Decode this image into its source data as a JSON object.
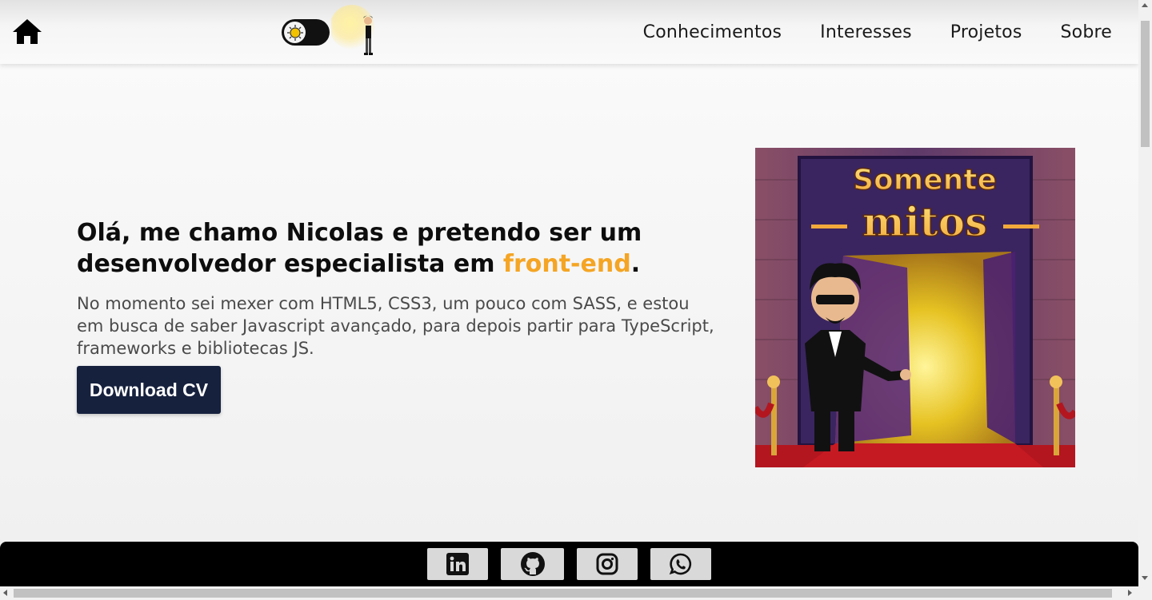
{
  "header": {
    "nav": [
      {
        "label": "Conhecimentos"
      },
      {
        "label": "Interesses"
      },
      {
        "label": "Projetos"
      },
      {
        "label": "Sobre"
      }
    ],
    "icons": {
      "home": "home-icon",
      "theme": "sun-icon"
    }
  },
  "hero": {
    "title_part1": "Olá, me chamo Nicolas e pretendo ser um desenvolvedor especialista em ",
    "title_accent": "front-end",
    "title_end": ".",
    "description": "No momento sei mexer com HTML5, CSS3, um pouco com SASS, e estou em busca de saber Javascript avançado, para depois partir para TypeScript, frameworks e bibliotecas JS.",
    "download_label": "Download CV",
    "image_text_line1": "Somente",
    "image_text_line2": "mitos"
  },
  "footer": {
    "social": [
      {
        "icon": "linkedin-icon"
      },
      {
        "icon": "github-icon"
      },
      {
        "icon": "instagram-icon"
      },
      {
        "icon": "whatsapp-icon"
      }
    ]
  },
  "colors": {
    "accent": "#f5a524",
    "button": "#16213e",
    "footer": "#000000"
  }
}
